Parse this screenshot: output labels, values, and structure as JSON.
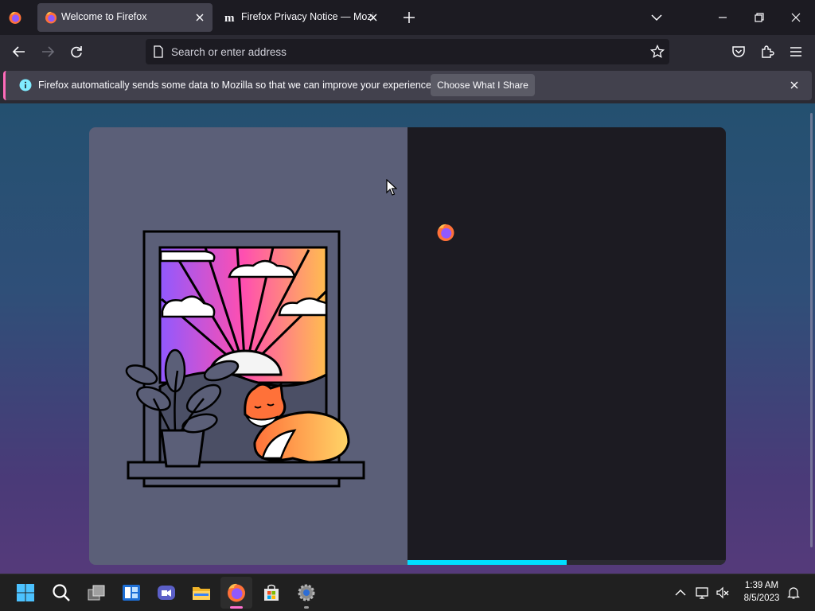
{
  "tabs": [
    {
      "title": "Welcome to Firefox",
      "favicon": "firefox-icon",
      "active": true
    },
    {
      "title": "Firefox Privacy Notice — Mozilla",
      "favicon": "mozilla-m-icon",
      "active": false
    }
  ],
  "urlbar": {
    "placeholder": "Search or enter address"
  },
  "notification": {
    "message": "Firefox automatically sends some data to Mozilla so that we can improve your experience.",
    "button_label": "Choose What I Share"
  },
  "onboarding": {
    "progress": 0.5
  },
  "taskbar": {
    "apps": [
      "start-icon",
      "search-icon",
      "task-view-icon",
      "widgets-icon",
      "teams-chat-icon",
      "file-explorer-icon",
      "firefox-icon",
      "microsoft-store-icon",
      "settings-icon"
    ],
    "time": "1:39 AM",
    "date": "8/5/2023"
  },
  "colors": {
    "accent": "#00ddff",
    "notification_stripe": "#ff6bba",
    "taskbar_active": "#ff71d0"
  }
}
